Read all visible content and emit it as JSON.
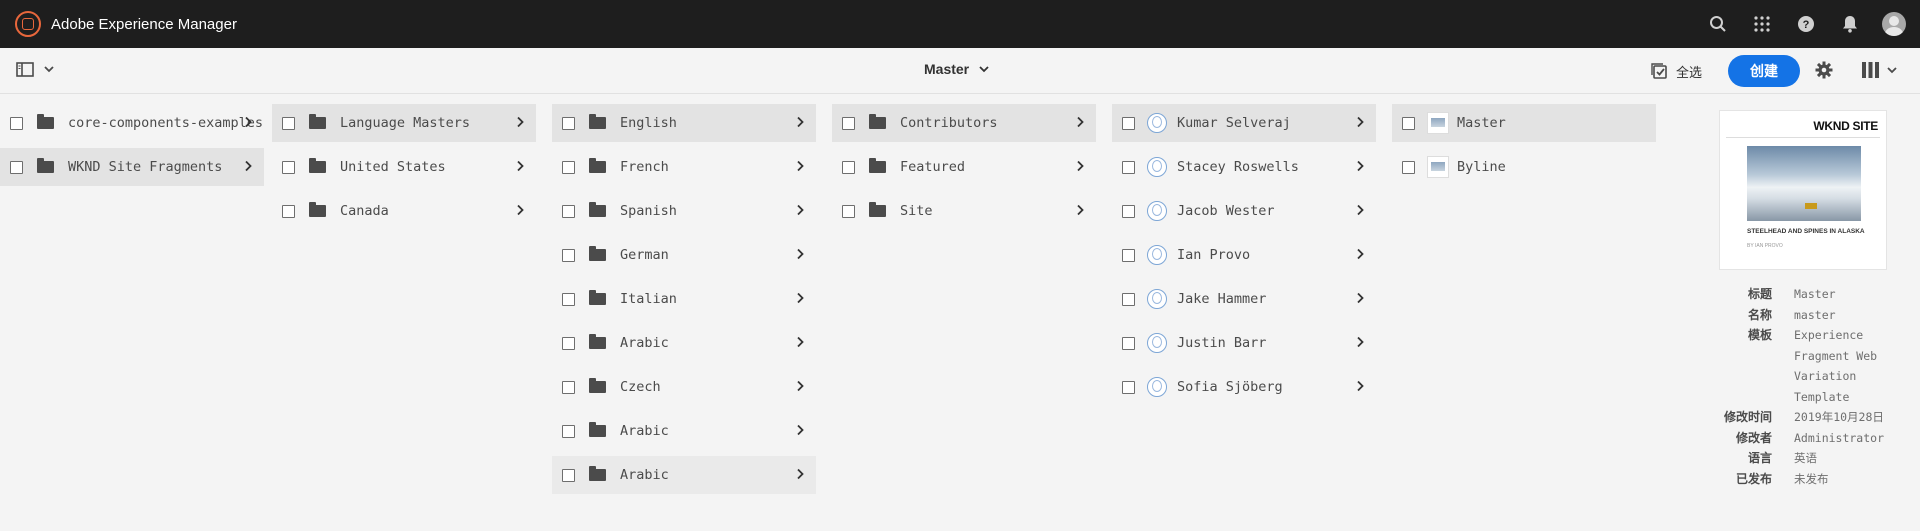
{
  "shell": {
    "title": "Adobe Experience Manager"
  },
  "actionbar": {
    "breadcrumb": "Master",
    "select_all": "全选",
    "create": "创建"
  },
  "columns": [
    {
      "items": [
        {
          "label": "core-components-examples",
          "icon": "folder-icon",
          "state": ""
        },
        {
          "label": "WKND Site Fragments",
          "icon": "folder-icon",
          "state": "selected"
        }
      ]
    },
    {
      "items": [
        {
          "label": "Language Masters",
          "icon": "folder-icon",
          "state": "selected"
        },
        {
          "label": "United States",
          "icon": "folder-icon",
          "state": ""
        },
        {
          "label": "Canada",
          "icon": "folder-icon",
          "state": ""
        }
      ]
    },
    {
      "items": [
        {
          "label": "English",
          "icon": "folder-icon",
          "state": "selected"
        },
        {
          "label": "French",
          "icon": "folder-icon",
          "state": ""
        },
        {
          "label": "Spanish",
          "icon": "folder-icon",
          "state": ""
        },
        {
          "label": "German",
          "icon": "folder-icon",
          "state": ""
        },
        {
          "label": "Italian",
          "icon": "folder-icon",
          "state": ""
        },
        {
          "label": "Arabic",
          "icon": "folder-icon",
          "state": ""
        },
        {
          "label": "Czech",
          "icon": "folder-icon",
          "state": ""
        },
        {
          "label": "Arabic",
          "icon": "folder-icon",
          "state": ""
        },
        {
          "label": "Arabic",
          "icon": "folder-icon",
          "state": "hover"
        }
      ]
    },
    {
      "items": [
        {
          "label": "Contributors",
          "icon": "folder-icon",
          "state": "selected"
        },
        {
          "label": "Featured",
          "icon": "folder-icon",
          "state": ""
        },
        {
          "label": "Site",
          "icon": "folder-icon",
          "state": ""
        }
      ]
    },
    {
      "items": [
        {
          "label": "Kumar Selveraj",
          "icon": "globe-icon",
          "state": "selected"
        },
        {
          "label": "Stacey Roswells",
          "icon": "globe-icon",
          "state": ""
        },
        {
          "label": "Jacob Wester",
          "icon": "globe-icon",
          "state": ""
        },
        {
          "label": "Ian Provo",
          "icon": "globe-icon",
          "state": ""
        },
        {
          "label": "Jake Hammer",
          "icon": "globe-icon",
          "state": ""
        },
        {
          "label": "Justin Barr",
          "icon": "globe-icon",
          "state": ""
        },
        {
          "label": "Sofia Sjöberg",
          "icon": "globe-icon",
          "state": ""
        }
      ]
    },
    {
      "items": [
        {
          "label": "Master",
          "icon": "thumbnail-icon",
          "state": "selected",
          "leaf": true
        },
        {
          "label": "Byline",
          "icon": "thumbnail-icon",
          "state": "",
          "leaf": true
        }
      ]
    }
  ],
  "preview": {
    "brand": "WKND SITE",
    "caption": "STEELHEAD AND SPINES IN ALASKA",
    "byline": "BY IAN PROVO"
  },
  "meta": [
    {
      "key": "标题",
      "value": "Master"
    },
    {
      "key": "名称",
      "value": "master"
    },
    {
      "key": "模板",
      "value": "Experience Fragment Web Variation Template"
    },
    {
      "key": "修改时间",
      "value": "2019年10月28日"
    },
    {
      "key": "修改者",
      "value": "Administrator"
    },
    {
      "key": "语言",
      "value": "英语"
    },
    {
      "key": "已发布",
      "value": "未发布"
    }
  ],
  "colors": {
    "accent": "#1473e6",
    "shell": "#1e1e1e",
    "logo": "#e8673c"
  }
}
